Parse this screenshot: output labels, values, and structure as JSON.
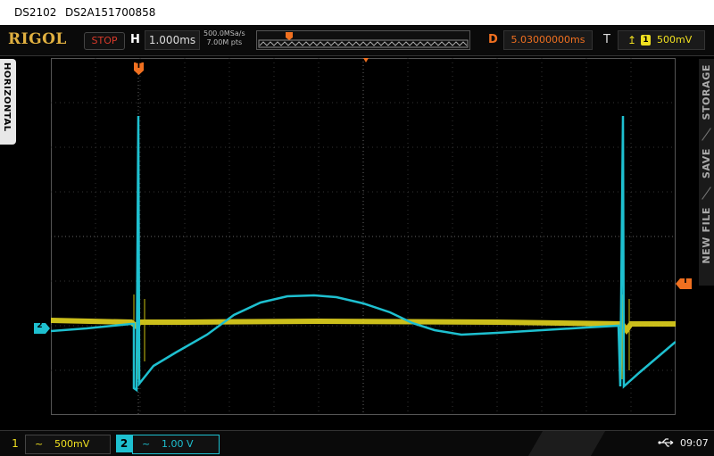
{
  "titlebar": {
    "model": "DS2102",
    "serial": "DS2A151700858"
  },
  "header": {
    "brand": "RIGOL",
    "run_state": "STOP",
    "horizontal_label": "H",
    "timebase": "1.000ms",
    "sample_rate": "500.0MSa/s",
    "memory_depth": "7.00M pts",
    "delay_label": "D",
    "delay_value": "5.03000000ms",
    "trigger_label": "T",
    "trigger_source": "1",
    "trigger_level": "500mV"
  },
  "left_tab": {
    "label": "HORIZONTAL"
  },
  "right_menu": {
    "items": [
      "STORAGE",
      "SAVE",
      "NEW FILE"
    ]
  },
  "markers": {
    "trigger": "T",
    "channel2": "2"
  },
  "channels": {
    "ch1": {
      "number": "1",
      "coupling": "~",
      "scale": "500mV",
      "color": "#f0e020"
    },
    "ch2": {
      "number": "2",
      "coupling": "~",
      "scale": "1.00 V",
      "color": "#1ec0d0"
    }
  },
  "status": {
    "time": "09:07",
    "usb_icon": "usb-icon"
  }
}
